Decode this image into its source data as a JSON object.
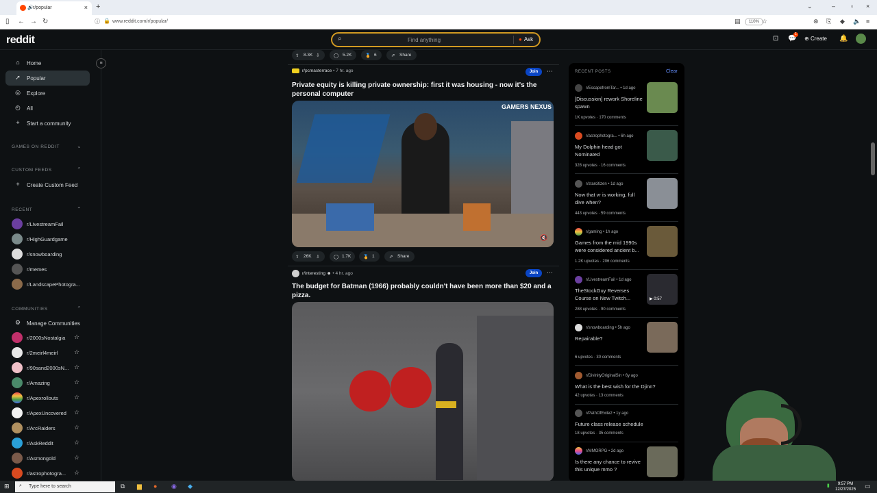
{
  "browser": {
    "tab_title": "r/popular",
    "url": "www.reddit.com/r/popular/",
    "zoom": "110%"
  },
  "header": {
    "logo": "reddit",
    "search_placeholder": "Find anything",
    "ask_label": "Ask",
    "create_label": "Create",
    "notif_count": "1"
  },
  "sidebar": {
    "nav": [
      {
        "label": "Home",
        "icon": "home-icon"
      },
      {
        "label": "Popular",
        "icon": "popular-icon"
      },
      {
        "label": "Explore",
        "icon": "explore-icon"
      },
      {
        "label": "All",
        "icon": "all-icon"
      },
      {
        "label": "Start a community",
        "icon": "plus-icon"
      }
    ],
    "games_header": "GAMES ON REDDIT",
    "custom_feeds_header": "CUSTOM FEEDS",
    "create_custom_feed": "Create Custom Feed",
    "recent_header": "RECENT",
    "recent": [
      {
        "label": "r/LivestreamFail",
        "color": "#6b3fa0"
      },
      {
        "label": "r/HighGuardgame",
        "color": "#7a8a8a"
      },
      {
        "label": "r/snowboarding",
        "color": "#dddddd"
      },
      {
        "label": "r/memes",
        "color": "#555555"
      },
      {
        "label": "r/LandscapePhotogra...",
        "color": "#8a6a4a"
      }
    ],
    "communities_header": "COMMUNITIES",
    "manage_communities": "Manage Communities",
    "communities": [
      {
        "label": "r/2000sNostalgia",
        "color": "#c0306a"
      },
      {
        "label": "r/2meirl4meirl",
        "color": "#e8e8e8"
      },
      {
        "label": "r/90sand2000sN...",
        "color": "#f0c0c8"
      },
      {
        "label": "r/Amazing",
        "color": "#4a8a6a"
      },
      {
        "label": "r/Apexrollouts",
        "color": "#e84a4a"
      },
      {
        "label": "r/ApexUncovered",
        "color": "#f2f2f2"
      },
      {
        "label": "r/ArcRaiders",
        "color": "#b09060"
      },
      {
        "label": "r/AskReddit",
        "color": "#2aa0d8"
      },
      {
        "label": "r/Asmongold",
        "color": "#7a5a4a"
      },
      {
        "label": "r/astrophotogra...",
        "color": "#d84a20"
      }
    ]
  },
  "feed": {
    "top_actions": {
      "votes": "8.3K",
      "comments": "5.2K",
      "awards": "6",
      "share": "Share"
    },
    "posts": [
      {
        "subreddit": "r/pcmasterrace",
        "age": "7 hr. ago",
        "join": "Join",
        "title": "Private equity is killing private ownership: first it was housing - now it's the personal computer",
        "media_overlay": "GAMERS NEXUS",
        "votes": "26K",
        "comments": "1.7K",
        "awards": "1",
        "share": "Share"
      },
      {
        "subreddit": "r/interesting",
        "age": "4 hr. ago",
        "join": "Join",
        "title": "The budget for Batman (1966) probably couldn't have been more than $20 and a pizza."
      }
    ]
  },
  "recent_posts": {
    "header": "RECENT POSTS",
    "clear": "Clear",
    "items": [
      {
        "sub": "r/EscapefromTar...",
        "age": "1d ago",
        "title": "[Discussion] rework Shoreline spawn",
        "upvotes": "1K upvotes",
        "comments": "170 comments",
        "thumb": "#6a8a50"
      },
      {
        "sub": "r/astrophotogra...",
        "age": "6h ago",
        "title": "My Dolphin head got Nominated",
        "upvotes": "328 upvotes",
        "comments": "16 comments",
        "thumb": "#3a5a4a"
      },
      {
        "sub": "r/starcitizen",
        "age": "1d ago",
        "title": "Now that vr is working, full dive when?",
        "upvotes": "443 upvotes",
        "comments": "59 comments",
        "thumb": "#8a8f96"
      },
      {
        "sub": "r/gaming",
        "age": "1h ago",
        "title": "Games from the mid 1990s were considered ancient b...",
        "upvotes": "1.2K upvotes",
        "comments": "206 comments",
        "thumb": "#6a5a3a"
      },
      {
        "sub": "r/LivestreamFail",
        "age": "1d ago",
        "title": "TheStockGuy Reverses Course on New Twitch...",
        "upvotes": "288 upvotes",
        "comments": "90 comments",
        "thumb": "#2a2a30",
        "duration": "0:57"
      },
      {
        "sub": "r/snowboarding",
        "age": "5h ago",
        "title": "Repairable?",
        "upvotes": "6 upvotes",
        "comments": "30 comments",
        "thumb": "#7a6a5a"
      },
      {
        "sub": "r/DivinityOriginalSin",
        "age": "6y ago",
        "title": "What is the best wish for the Djinn?",
        "upvotes": "42 upvotes",
        "comments": "13 comments"
      },
      {
        "sub": "r/PathOfExile2",
        "age": "1y ago",
        "title": "Future class release schedule",
        "upvotes": "18 upvotes",
        "comments": "35 comments"
      },
      {
        "sub": "r/MMORPG",
        "age": "2d ago",
        "title": "Is there any chance to revive this unique mmo ?",
        "upvotes": "",
        "comments": "",
        "thumb": "#6a6a5a"
      }
    ]
  },
  "taskbar": {
    "search_placeholder": "Type here to search",
    "time": "9:57 PM",
    "date": "12/27/2025"
  }
}
